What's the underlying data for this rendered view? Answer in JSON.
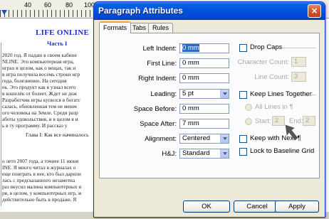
{
  "document": {
    "ruler_numbers": [
      "40",
      "60",
      "80",
      "100"
    ],
    "title": "LIFE ONLINE",
    "part": "Часть I",
    "chapter_heading": "Глава I: Как все начиналось",
    "lines_top": [
      "2020 год. Я падаю в своем кабине",
      "NLINE. Это компьютерная игра,",
      "играх в целом, как о вещах, так и",
      "в игра получила восемь строки игр",
      "года, болезненно. На сегодня",
      "ек. Это продукт как я узнал всего",
      "в кошелёк от болеет. Ждет не дож",
      "Разработчик игры купился в богатс",
      "салась, обновленная тем не менее",
      "ого человека на Земле. Среди разр",
      "аботы удовольствия, и в целом я и",
      "ь в ту программу. И рассказ у"
    ],
    "lines_bottom": [
      "о лето 2007 года, а точнее 11 июня",
      "INE. Я много читал в журналах о",
      "еще поиграть в нее, кто был дарили",
      "лась с предсказанного незаметна",
      "раз вкусил малина компьютерных и",
      "рв, в целом, у компьютерных игр, ж",
      "действительно быть в продаже. Я"
    ]
  },
  "dialog": {
    "title": "Paragraph Attributes",
    "close_label": "×",
    "tabs": [
      {
        "label": "Formats",
        "active": true
      },
      {
        "label": "Tabs",
        "active": false
      },
      {
        "label": "Rules",
        "active": false
      }
    ],
    "fields": {
      "left_indent": {
        "label": "Left Indent:",
        "value": "0 mm"
      },
      "first_line": {
        "label": "First Line:",
        "value": "0 mm"
      },
      "right_indent": {
        "label": "Right Indent:",
        "value": "0 mm"
      },
      "leading": {
        "label": "Leading:",
        "value": "5 pt"
      },
      "space_before": {
        "label": "Space Before:",
        "value": "0 mm"
      },
      "space_after": {
        "label": "Space After:",
        "value": "7 mm"
      },
      "alignment": {
        "label": "Alignment:",
        "value": "Centered"
      },
      "hj": {
        "label": "H&J:",
        "value": "Standard"
      }
    },
    "drop_caps": {
      "label": "Drop Caps",
      "checked": false,
      "character_count_label": "Character Count:",
      "character_count_value": "1",
      "line_count_label": "Line Count:",
      "line_count_value": "3"
    },
    "keep_lines_together": {
      "label": "Keep Lines Together",
      "checked": false,
      "all_lines_label": "All Lines in ¶",
      "start_label": "Start:",
      "start_value": "2",
      "end_label": "End:",
      "end_value": "2"
    },
    "keep_with_next": {
      "label": "Keep with Next ¶",
      "checked": false
    },
    "lock_to_baseline": {
      "label": "Lock to Baseline Grid",
      "checked": false
    },
    "buttons": {
      "ok": "OK",
      "cancel": "Cancel",
      "apply": "Apply"
    }
  },
  "colors": {
    "titlebar": "#0052e0",
    "active_tab_accent": "#f4a53a",
    "doc_heading": "#1a2fd0",
    "pointer_arrow": "#555555"
  }
}
